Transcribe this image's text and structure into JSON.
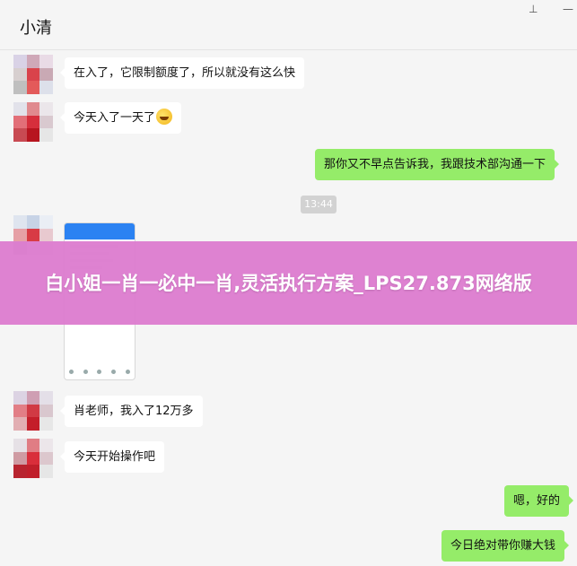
{
  "window": {
    "pin_icon": "pin-icon",
    "minimize_icon": "minimize-icon"
  },
  "header": {
    "title": "小清"
  },
  "timestamp": "13:44",
  "messages": [
    {
      "side": "in",
      "text": "在入了，它限制额度了，所以就没有这么快"
    },
    {
      "side": "in",
      "text": "今天入了一天了"
    },
    {
      "side": "out",
      "text": "那你又不早点告诉我，我跟技术部沟通一下"
    },
    {
      "side": "in",
      "text": "肖老师，我入了12万多"
    },
    {
      "side": "in",
      "text": "今天开始操作吧"
    },
    {
      "side": "out",
      "text": "嗯，好的"
    },
    {
      "side": "out",
      "text": "今日绝对带你赚大钱"
    }
  ],
  "banner": {
    "text": "白小姐一肖一必中一肖,灵活执行方案_LPS27.873网络版"
  },
  "colors": {
    "outgoing_bubble": "#95ec69",
    "incoming_bubble": "#ffffff",
    "banner": "#db79ce",
    "phone_bar": "#2b82f2"
  }
}
